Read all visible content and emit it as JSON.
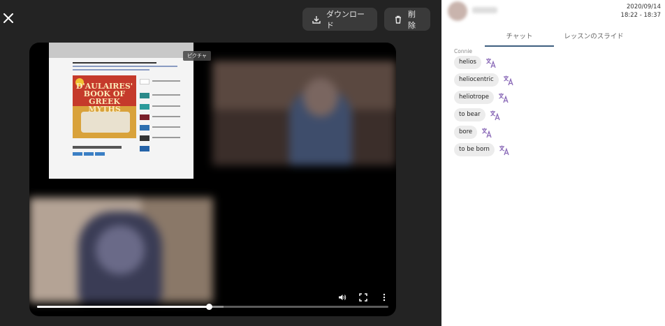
{
  "toolbar": {
    "download_label": "ダウンロード",
    "delete_label": "削除"
  },
  "player": {
    "pip_tooltip": "ピクチャ",
    "progress_fraction": 0.49,
    "buffered_fraction": 0.53
  },
  "shared_screen": {
    "book_title": "D'AULAIRES' BOOK OF GREEK MYTHS"
  },
  "session": {
    "date": "2020/09/14",
    "time": "18:22 - 18:37"
  },
  "tabs": [
    {
      "label": "チャット",
      "active": true
    },
    {
      "label": "レッスンのスライド",
      "active": false
    }
  ],
  "chat": {
    "sender": "Connie",
    "messages": [
      "helios",
      "heliocentric",
      "heliotrope",
      "to bear",
      "bore",
      "to be born"
    ]
  },
  "colors": {
    "accent": "#3f5f7f",
    "translate_icon": "#8b6bb8"
  }
}
